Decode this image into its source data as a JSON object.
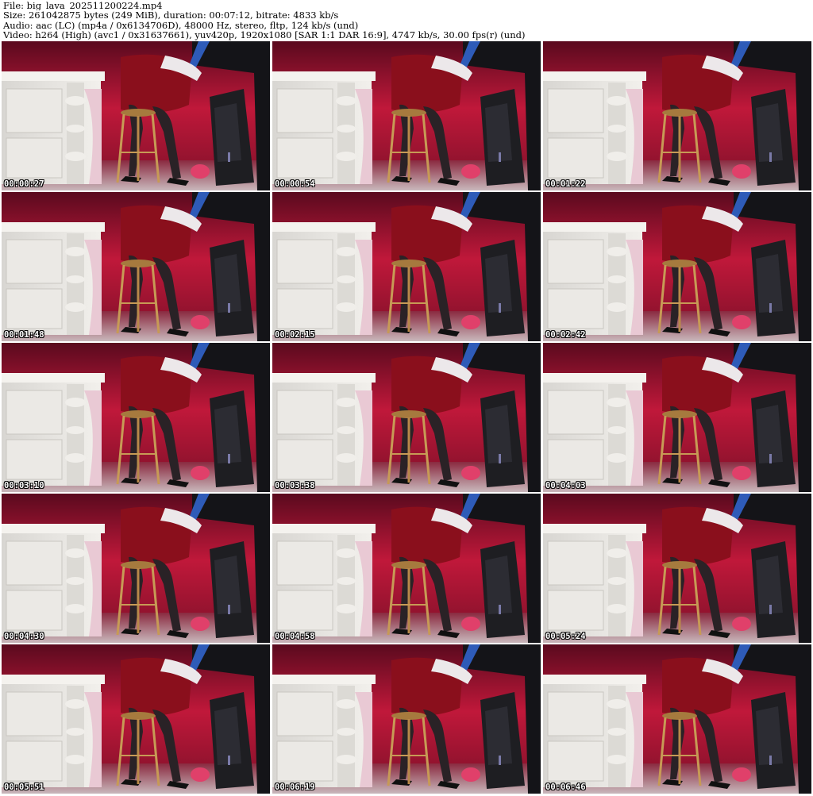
{
  "header": {
    "file_line": "File: big_lava_202511200224.mp4",
    "size_line": "Size: 261042875 bytes (249 MiB), duration: 00:07:12, bitrate: 4833 kb/s",
    "audio_line": "Audio: aac (LC) (mp4a / 0x6134706D), 48000 Hz, stereo, fltp, 124 kb/s (und)",
    "video_line": "Video: h264 (High) (avc1 / 0x31637661), yuv420p, 1920x1080 [SAR 1:1 DAR 16:9], 4747 kb/s, 30.00 fps(r) (und)"
  },
  "thumbnails": [
    {
      "timestamp": "00:00:27"
    },
    {
      "timestamp": "00:00:54"
    },
    {
      "timestamp": "00:01:22"
    },
    {
      "timestamp": "00:01:48"
    },
    {
      "timestamp": "00:02:15"
    },
    {
      "timestamp": "00:02:42"
    },
    {
      "timestamp": "00:03:10"
    },
    {
      "timestamp": "00:03:38"
    },
    {
      "timestamp": "00:04:03"
    },
    {
      "timestamp": "00:04:30"
    },
    {
      "timestamp": "00:04:58"
    },
    {
      "timestamp": "00:05:24"
    },
    {
      "timestamp": "00:05:51"
    },
    {
      "timestamp": "00:06:19"
    },
    {
      "timestamp": "00:06:46"
    }
  ],
  "colors": {
    "wall_red": "#c0183a",
    "wall_dark": "#5a0a1e",
    "desk_white": "#e8e6e2",
    "pc_case": "#1e1e22",
    "dress_red": "#8a0f1c",
    "stocking": "#2a2226",
    "stool_wood": "#c79a55",
    "timestamp_text": "#ffffff"
  }
}
